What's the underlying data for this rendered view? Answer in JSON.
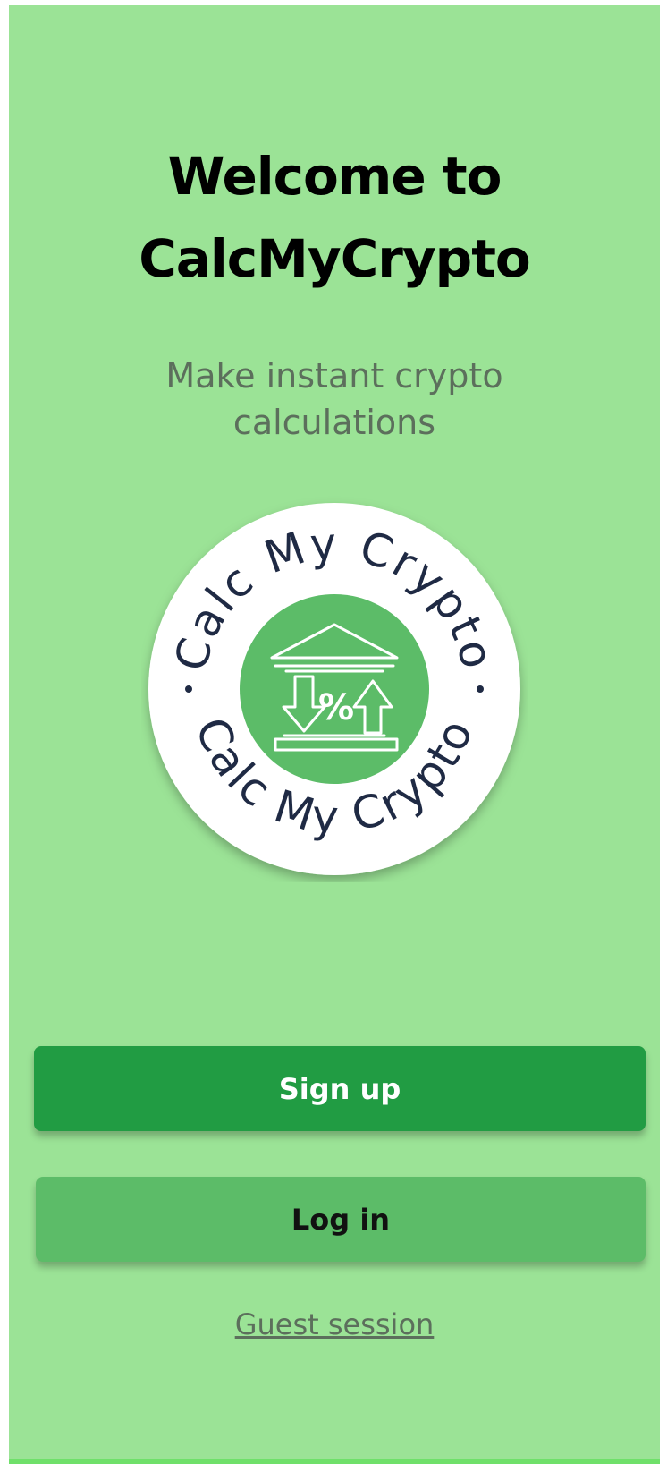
{
  "welcome": {
    "title_line1": "Welcome to",
    "title_line2": "CalcMyCrypto",
    "subtitle": "Make instant crypto calculations"
  },
  "logo": {
    "ring_text_top": "Calc My Crypto",
    "ring_text_bottom": "Calc My Crypto",
    "center_symbol": "%",
    "icon": "bank-percent-arrows-icon"
  },
  "actions": {
    "signup_label": "Sign up",
    "login_label": "Log in",
    "guest_label": "Guest session"
  },
  "colors": {
    "background": "#9be396",
    "primary_button": "#219c43",
    "secondary_button": "#5cbc68",
    "logo_inner": "#5cbc68",
    "logo_ring": "#ffffff",
    "logo_text": "#1f2a44"
  }
}
